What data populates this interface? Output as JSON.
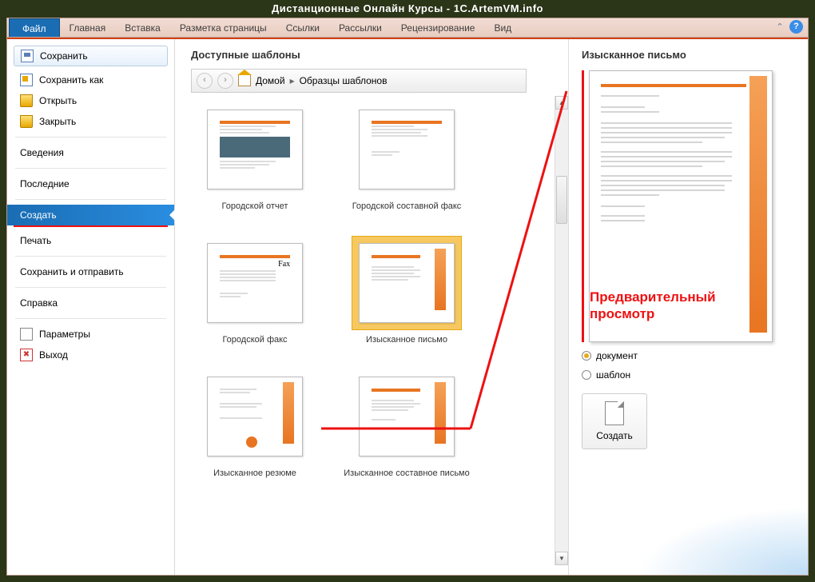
{
  "app_title": "Дистанционные Онлайн Курсы - 1C.ArtemVM.info",
  "ribbon": {
    "file": "Файл",
    "tabs": [
      "Главная",
      "Вставка",
      "Разметка страницы",
      "Ссылки",
      "Рассылки",
      "Рецензирование",
      "Вид"
    ]
  },
  "sidebar": {
    "save": "Сохранить",
    "save_as": "Сохранить как",
    "open": "Открыть",
    "close": "Закрыть",
    "info": "Сведения",
    "recent": "Последние",
    "new": "Создать",
    "print": "Печать",
    "save_send": "Сохранить и отправить",
    "help": "Справка",
    "options": "Параметры",
    "exit": "Выход"
  },
  "templates": {
    "heading": "Доступные шаблоны",
    "breadcrumb_home": "Домой",
    "breadcrumb_current": "Образцы шаблонов",
    "items": [
      {
        "label": "Городской отчет"
      },
      {
        "label": "Городской составной факс"
      },
      {
        "label": "Городской факс",
        "fax_text": "Fax"
      },
      {
        "label": "Изысканное письмо"
      },
      {
        "label": "Изысканное резюме"
      },
      {
        "label": "Изысканное составное письмо"
      }
    ]
  },
  "preview": {
    "title": "Изысканное письмо",
    "overlay_text": "Предварительный просмотр",
    "radio_document": "документ",
    "radio_template": "шаблон",
    "create_btn": "Создать"
  }
}
